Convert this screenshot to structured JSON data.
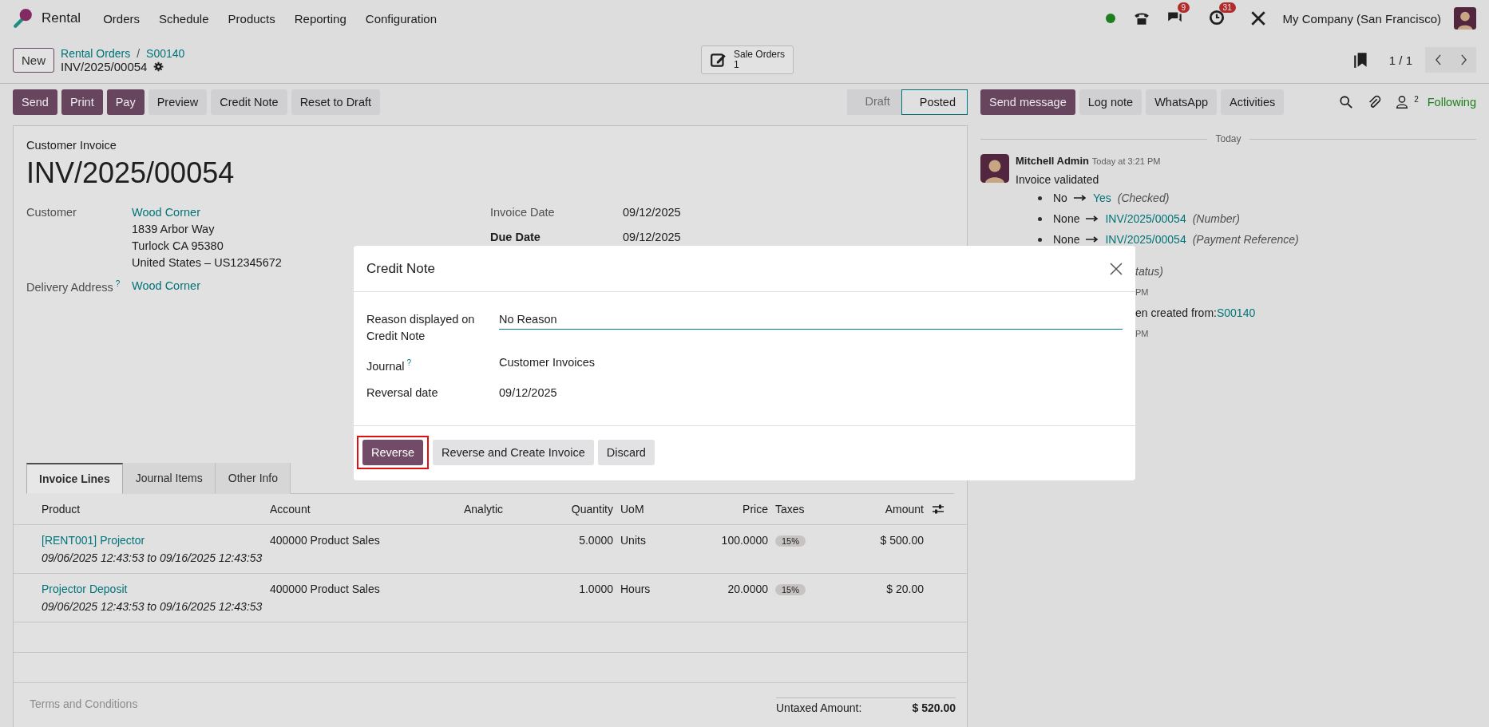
{
  "nav": {
    "app": "Rental",
    "menu": [
      "Orders",
      "Schedule",
      "Products",
      "Reporting",
      "Configuration"
    ],
    "messages_badge": "9",
    "activities_badge": "31",
    "company": "My Company (San Francisco)"
  },
  "control_panel": {
    "new_label": "New",
    "breadcrumbs": [
      "Rental Orders",
      "S00140"
    ],
    "separator": "/",
    "record": "INV/2025/00054",
    "smart_button": {
      "label": "Sale Orders",
      "count": "1"
    },
    "pager": "1 / 1"
  },
  "actions": [
    {
      "label": "Send",
      "primary": true
    },
    {
      "label": "Print",
      "primary": true
    },
    {
      "label": "Pay",
      "primary": true
    },
    {
      "label": "Preview",
      "primary": false
    },
    {
      "label": "Credit Note",
      "primary": false
    },
    {
      "label": "Reset to Draft",
      "primary": false
    }
  ],
  "status_steps": [
    {
      "label": "Draft",
      "selected": false
    },
    {
      "label": "Posted",
      "selected": true
    }
  ],
  "chatter_actions": [
    {
      "label": "Send message",
      "primary": true
    },
    {
      "label": "Log note",
      "primary": false
    },
    {
      "label": "WhatsApp",
      "primary": false
    },
    {
      "label": "Activities",
      "primary": false
    }
  ],
  "followers_count": "2",
  "follow_label": "Following",
  "form": {
    "type": "Customer Invoice",
    "name": "INV/2025/00054",
    "customer_label": "Customer",
    "customer": "Wood Corner",
    "address": [
      "1839 Arbor Way",
      "Turlock CA 95380",
      "United States – US12345672"
    ],
    "delivery_label": "Delivery Address",
    "delivery_help": "?",
    "delivery": "Wood Corner",
    "dates": [
      {
        "label": "Invoice Date",
        "value": "09/12/2025",
        "emphasis": false
      },
      {
        "label": "Due Date",
        "value": "09/12/2025",
        "emphasis": true
      }
    ]
  },
  "tabs": [
    {
      "label": "Invoice Lines",
      "selected": true
    },
    {
      "label": "Journal Items",
      "selected": false
    },
    {
      "label": "Other Info",
      "selected": false
    }
  ],
  "table": {
    "columns": [
      "Product",
      "Account",
      "Analytic",
      "Quantity",
      "UoM",
      "Price",
      "Taxes",
      "Amount"
    ],
    "rows": [
      {
        "product": "[RENT001] Projector",
        "period": "09/06/2025 12:43:53 to 09/16/2025 12:43:53",
        "account": "400000 Product Sales",
        "quantity": "5.0000",
        "uom": "Units",
        "price": "100.0000",
        "tax": "15%",
        "amount": "$ 500.00"
      },
      {
        "product": "Projector Deposit",
        "period": "09/06/2025 12:43:53 to 09/16/2025 12:43:53",
        "account": "400000 Product Sales",
        "quantity": "1.0000",
        "uom": "Hours",
        "price": "20.0000",
        "tax": "15%",
        "amount": "$ 20.00"
      }
    ]
  },
  "terms_placeholder": "Terms and Conditions",
  "totals": [
    {
      "label": "Untaxed Amount:",
      "value": "$ 520.00"
    }
  ],
  "chatter": {
    "separator": "Today",
    "author": "Mitchell Admin",
    "time": "Today at 3:21 PM",
    "body": "Invoice validated",
    "changes": [
      {
        "old": "No",
        "new": "Yes",
        "field": "(Checked)"
      },
      {
        "old": "None",
        "new": "INV/2025/00054",
        "field": "(Number)"
      },
      {
        "old": "None",
        "new": "INV/2025/00054",
        "field": "(Payment Reference)"
      }
    ],
    "fragments": [
      {
        "kind": "field",
        "text": "tatus)"
      },
      {
        "kind": "time",
        "text": "PM"
      },
      {
        "kind": "text",
        "text": "en created from:",
        "link": "S00140"
      },
      {
        "kind": "time",
        "text": "PM"
      }
    ]
  },
  "dialog": {
    "title": "Credit Note",
    "fields": [
      {
        "kind": "input",
        "label": "Reason displayed on Credit Note",
        "value": "No Reason"
      },
      {
        "kind": "text",
        "label": "Journal",
        "help": "?",
        "value": "Customer Invoices"
      },
      {
        "kind": "text",
        "label": "Reversal date",
        "value": "09/12/2025"
      }
    ],
    "buttons": [
      {
        "label": "Reverse",
        "primary": true,
        "highlighted": true
      },
      {
        "label": "Reverse and Create Invoice",
        "primary": false,
        "highlighted": false
      },
      {
        "label": "Discard",
        "primary": false,
        "highlighted": false
      }
    ]
  }
}
